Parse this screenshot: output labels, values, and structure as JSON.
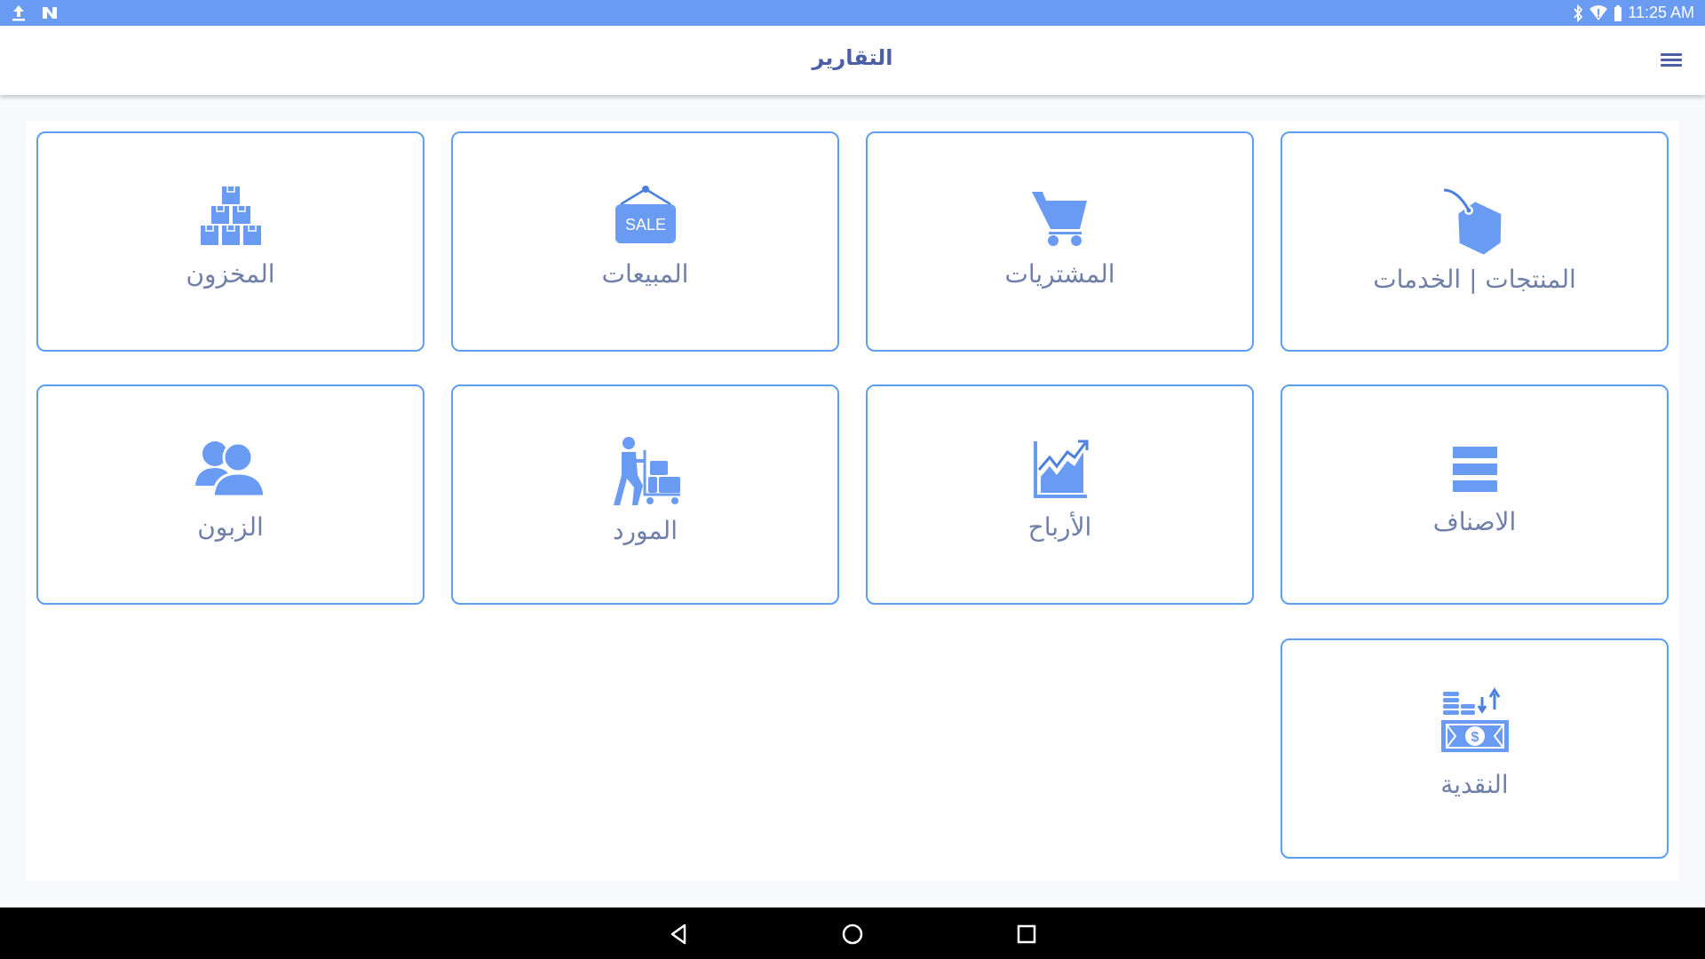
{
  "status_bar": {
    "time": "11:25 AM",
    "left_icons": [
      "upload-icon",
      "n-notification-icon"
    ],
    "right_icons": [
      "bluetooth-icon",
      "wifi-icon",
      "battery-icon"
    ]
  },
  "app_bar": {
    "title": "التقارير",
    "menu_icon": "hamburger-menu-icon"
  },
  "colors": {
    "status_bar": "#6a9bf2",
    "accent_blue": "#5d9ef0",
    "title_color": "#4b5fa8",
    "label_color": "#6f7fa8"
  },
  "reports": {
    "products": {
      "label": "المنتجات | الخدمات",
      "icon": "price-tag-icon"
    },
    "purchases": {
      "label": "المشتريات",
      "icon": "shopping-cart-icon"
    },
    "sales": {
      "label": "المبيعات",
      "icon": "sale-sign-icon",
      "icon_text": "SALE"
    },
    "inventory": {
      "label": "المخزون",
      "icon": "stacked-boxes-icon"
    },
    "categories": {
      "label": "الاصناف",
      "icon": "categories-icon"
    },
    "profits": {
      "label": "الأرباح",
      "icon": "profit-chart-icon"
    },
    "supplier": {
      "label": "المورد",
      "icon": "supplier-delivery-icon"
    },
    "customer": {
      "label": "الزبون",
      "icon": "customers-icon"
    },
    "cash": {
      "label": "النقدية",
      "icon": "cash-money-icon"
    }
  },
  "nav_bar": {
    "buttons": [
      "back-icon",
      "home-icon",
      "recents-icon"
    ]
  }
}
